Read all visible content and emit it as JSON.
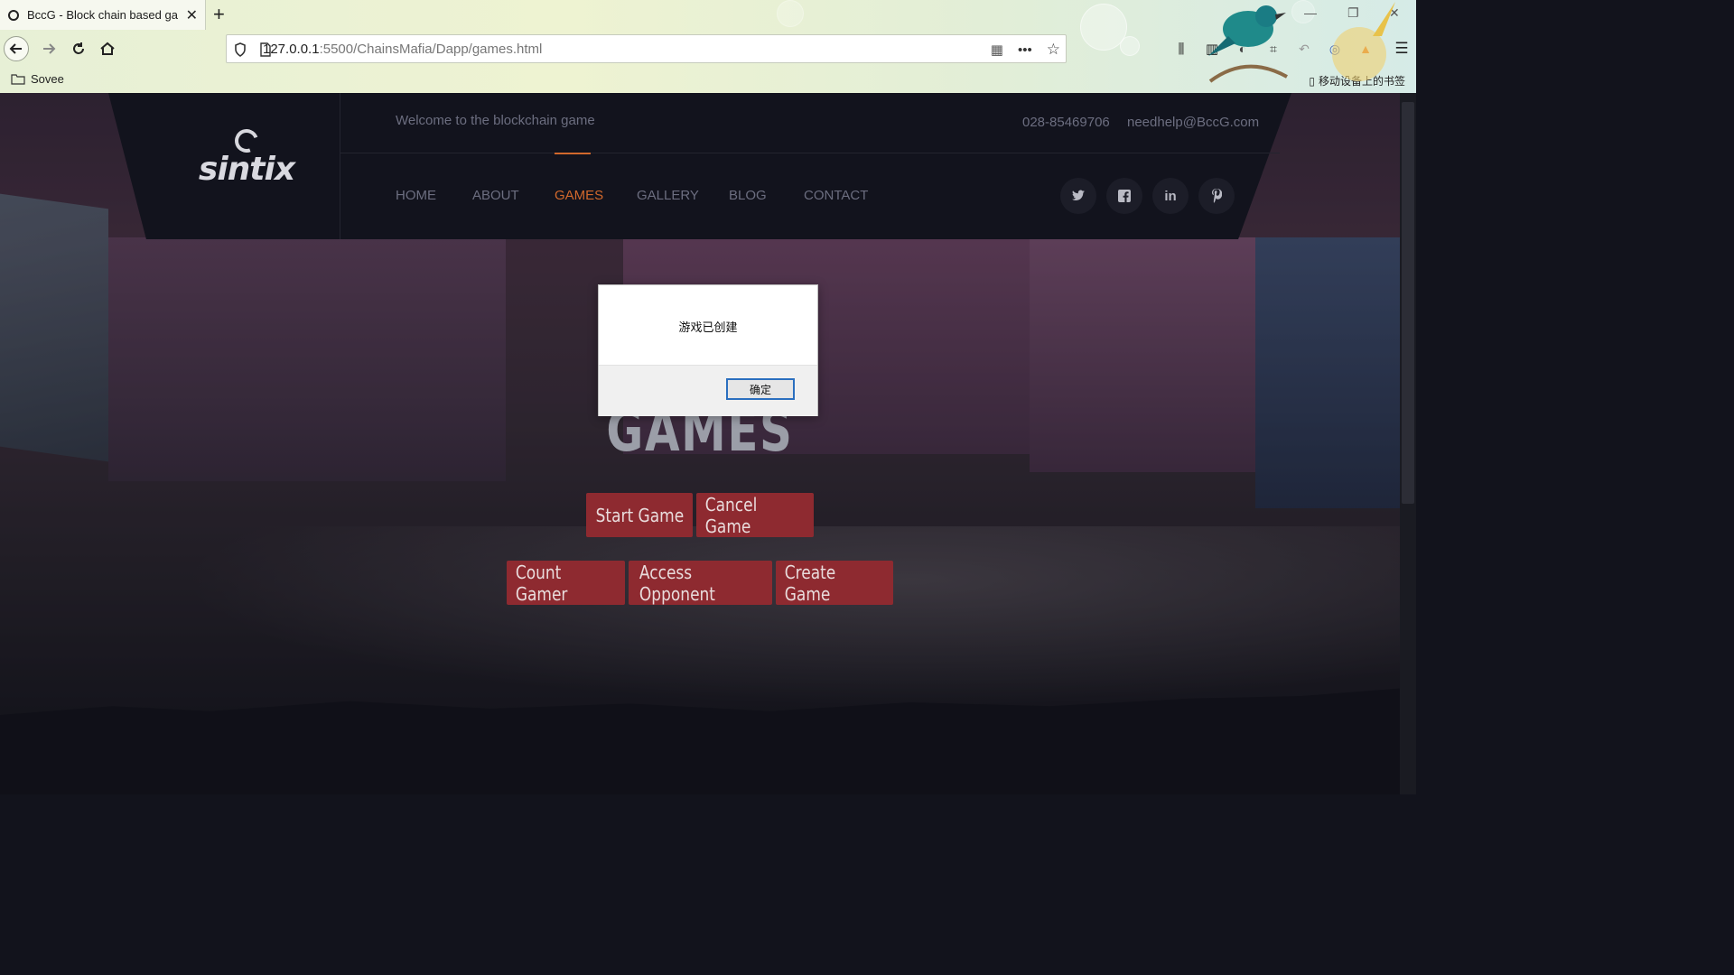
{
  "browser": {
    "tab_title": "BccG - Block chain based ga",
    "url_host": "127.0.0.1",
    "url_rest": ":5500/ChainsMafia/Dapp/games.html",
    "bookmark_folder": "Sovee",
    "mobile_bookmarks": "移动设备上的书签"
  },
  "header": {
    "logo_text": "sintix",
    "welcome": "Welcome to the blockchain game",
    "phone": "028-85469706",
    "email": "needhelp@BccG.com",
    "menu": [
      "HOME",
      "ABOUT",
      "GAMES",
      "GALLERY",
      "BLOG",
      "CONTACT"
    ],
    "active_menu": "GAMES",
    "social_icons": [
      "twitter-icon",
      "facebook-icon",
      "linkedin-icon",
      "pinterest-icon"
    ]
  },
  "hero": {
    "title": "GAMES",
    "buttons_row1": [
      "Start Game",
      "Cancel Game"
    ],
    "buttons_row2": [
      "Count Gamer",
      "Access Opponent",
      "Create Game"
    ]
  },
  "dialog": {
    "message": "游戏已创建",
    "ok_label": "确定"
  },
  "colors": {
    "accent": "#d1682c",
    "button": "#8e2a30",
    "header_bg": "#12131d"
  }
}
